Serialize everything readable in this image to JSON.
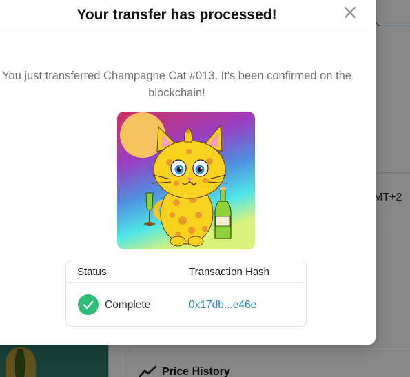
{
  "background": {
    "timezone_fragment": "MT+2",
    "price_history_title": "Price History"
  },
  "modal": {
    "title": "Your transfer has processed!",
    "message": "You just transferred Champagne Cat #013. It's been confirmed on the blockchain!",
    "image_alt": "Champagne Cat #013",
    "close_icon": "close-icon",
    "status_table": {
      "headers": [
        "Status",
        "Transaction Hash"
      ],
      "status": "Complete",
      "status_icon": "check-circle-icon",
      "status_color": "#2ebd74",
      "transaction_hash": "0x17db...e46e",
      "link_color": "#2a83c6"
    }
  }
}
